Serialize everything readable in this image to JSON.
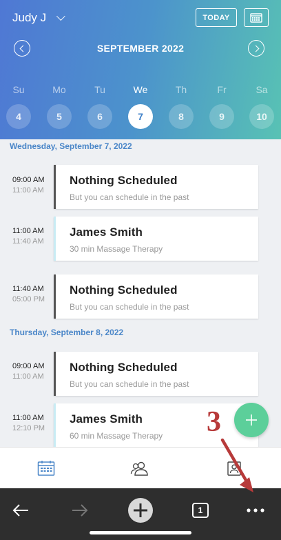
{
  "header": {
    "user_name": "Judy J",
    "today_label": "TODAY",
    "month_label": "SEPTEMBER 2022"
  },
  "week": {
    "days": [
      {
        "name": "Su",
        "num": "4"
      },
      {
        "name": "Mo",
        "num": "5"
      },
      {
        "name": "Tu",
        "num": "6"
      },
      {
        "name": "We",
        "num": "7"
      },
      {
        "name": "Th",
        "num": "8"
      },
      {
        "name": "Fr",
        "num": "9"
      },
      {
        "name": "Sa",
        "num": "10"
      }
    ],
    "selected_index": 3
  },
  "schedule": {
    "day1": {
      "heading": "Wednesday, September 7, 2022",
      "slots": [
        {
          "start": "09:00 AM",
          "end": "11:00 AM",
          "title": "Nothing Scheduled",
          "subtitle": "But you can schedule in the past"
        },
        {
          "start": "11:00 AM",
          "end": "11:40 AM",
          "title": "James Smith",
          "subtitle": "30 min Massage Therapy"
        },
        {
          "start": "11:40 AM",
          "end": "05:00 PM",
          "title": "Nothing Scheduled",
          "subtitle": "But you can schedule in the past"
        }
      ]
    },
    "day2": {
      "heading": "Thursday, September 8, 2022",
      "slots": [
        {
          "start": "09:00 AM",
          "end": "11:00 AM",
          "title": "Nothing Scheduled",
          "subtitle": "But you can schedule in the past"
        },
        {
          "start": "11:00 AM",
          "end": "12:10 PM",
          "title": "James Smith",
          "subtitle": "60 min Massage Therapy"
        }
      ]
    }
  },
  "annotation": {
    "label": "3",
    "color": "#b73a3a"
  },
  "browser": {
    "tab_count": "1"
  },
  "colors": {
    "accent": "#4a86c8",
    "fab": "#5ccf9a"
  },
  "icons": {
    "fab": "plus-icon",
    "tabs": [
      "calendar-icon",
      "clients-icon",
      "contacts-icon"
    ],
    "browser": [
      "back-arrow-icon",
      "forward-arrow-icon",
      "new-tab-plus-icon",
      "tab-count-icon",
      "more-dots-icon"
    ]
  }
}
